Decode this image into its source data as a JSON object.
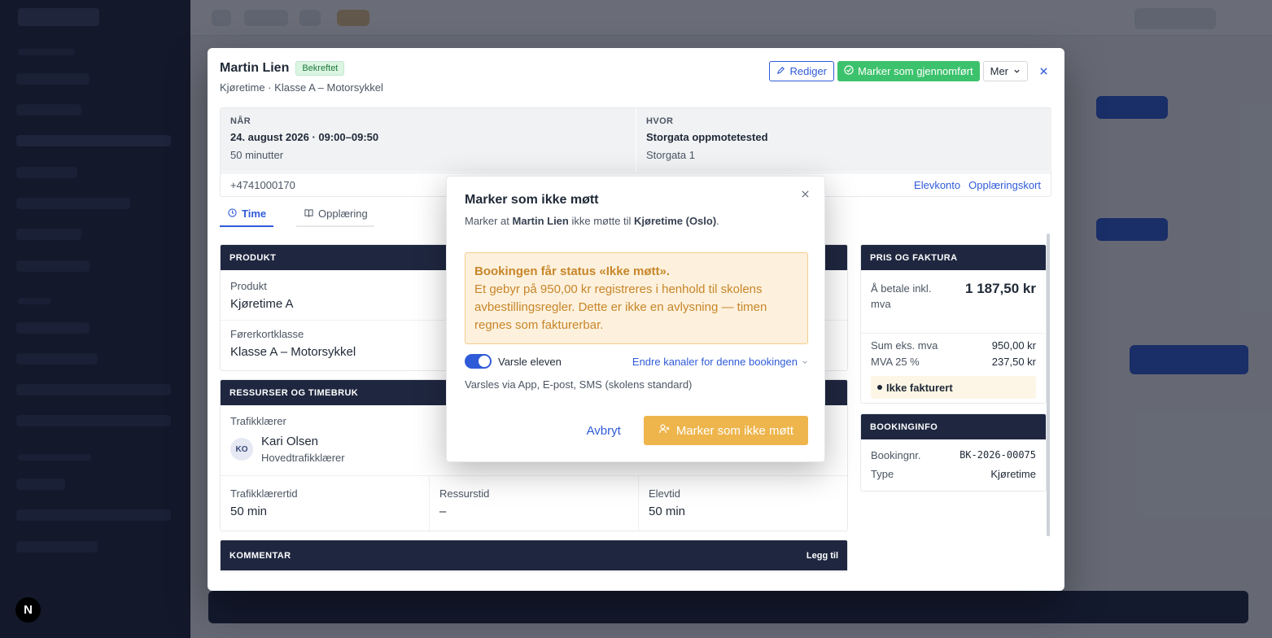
{
  "modal": {
    "name": "Martin Lien",
    "status_badge": "Bekreftet",
    "subtitle": "Kjøretime · Klasse A – Motorsykkel",
    "actions": {
      "edit": "Rediger",
      "complete": "Marker som gjennomført",
      "more": "Mer"
    },
    "when": {
      "label": "NÅR",
      "value": "24. august 2026 · 09:00–09:50",
      "duration": "50 minutter"
    },
    "where": {
      "label": "HVOR",
      "value": "Storgata oppmotetested",
      "address": "Storgata 1"
    },
    "phone": "+4741000170",
    "links": {
      "student_account": "Elevkonto",
      "training_card": "Opplæringskort"
    },
    "tabs": [
      {
        "label": "Time"
      },
      {
        "label": "Opplæring"
      }
    ],
    "product": {
      "header": "PRODUKT",
      "product_label": "Produkt",
      "product_value": "Kjøretime A",
      "class_label": "Førerkortklasse",
      "class_value": "Klasse A – Motorsykkel"
    },
    "resources": {
      "header": "RESSURSER OG TIMEBRUK",
      "instructor_label": "Trafikklærer",
      "instructor_initials": "KO",
      "instructor_name": "Kari Olsen",
      "instructor_role": "Hovedtrafikklærer",
      "teacher_time_label": "Trafikklærertid",
      "teacher_time": "50 min",
      "resource_time_label": "Ressurstid",
      "resource_time": "–",
      "student_time_label": "Elevtid",
      "student_time": "50 min"
    },
    "comment": {
      "header": "KOMMENTAR",
      "add": "Legg til"
    },
    "price": {
      "header": "PRIS OG FAKTURA",
      "total_label": "Å betale inkl. mva",
      "total_value": "1 187,50 kr",
      "net_label": "Sum eks. mva",
      "net_value": "950,00 kr",
      "vat_label": "MVA 25 %",
      "vat_value": "237,50 kr",
      "invoice_status": "Ikke fakturert"
    },
    "booking": {
      "header": "BOOKINGINFO",
      "number_label": "Bookingnr.",
      "number_value": "BK-2026-00075",
      "type_label": "Type",
      "type_value": "Kjøretime"
    }
  },
  "dialog": {
    "title": "Marker som ikke møtt",
    "desc_prefix": "Marker at ",
    "desc_name": "Martin Lien",
    "desc_middle": " ikke møtte til ",
    "desc_event": "Kjøretime (Oslo)",
    "desc_suffix": ".",
    "warning_title": "Bookingen får status «Ikke møtt».",
    "warning_body": "Et gebyr på 950,00 kr registreres i henhold til skolens avbestillingsregler. Dette er ikke en avlysning — timen regnes som fakturerbar.",
    "notify_label": "Varsle eleven",
    "notify_on": true,
    "channels_link": "Endre kanaler for denne bookingen",
    "channels_note": "Varsles via App, E-post, SMS (skolens standard)",
    "cancel": "Avbryt",
    "confirm": "Marker som ikke møtt"
  },
  "colors": {
    "accent": "#2f5bd8",
    "success": "#3cc26c",
    "warning": "#eeb54c",
    "panel_header": "#1f2740"
  }
}
